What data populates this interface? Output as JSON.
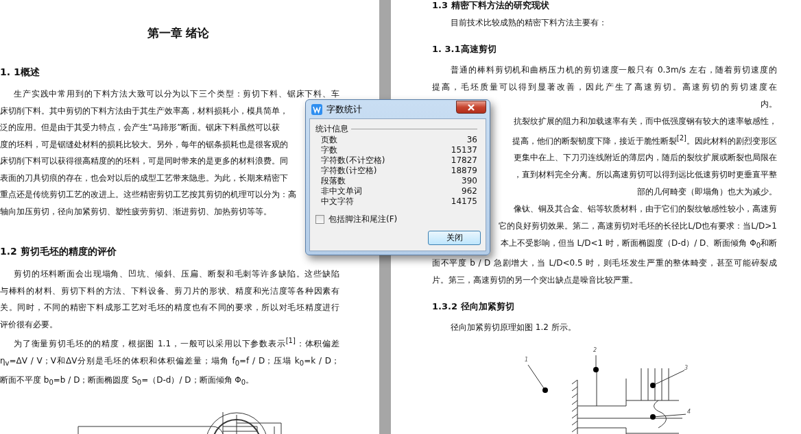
{
  "left_page": {
    "chapter_title": "第一章  绪论",
    "sections": [
      {
        "heading": "1. 1概述",
        "paragraphs": [
          [
            {
              "text": "生产实践中常用到的下料方法大致可以分为以下三个类型：剪切下料、锯床下料、车",
              "kind": "full"
            },
            {
              "text": "床切削下料。其中剪切的下料方法由于其生产效率高，材料损耗小，模具简单，",
              "kind": "covered"
            },
            {
              "text": "泛的应用。但是由于其受力特点，会产生“马蹄形”断面。锯床下料虽然可以获",
              "kind": "covered"
            },
            {
              "text": "度的坯料，可是锯缝处材料的损耗比较大。另外，每年的锯条损耗也是很客观的",
              "kind": "covered"
            },
            {
              "text": "床切削下料可以获得很高精度的的坯料，可是同时带来的是更多的材料浪费。同",
              "kind": "covered"
            },
            {
              "text": "表面的刀具切痕的存在，也会对以后的成型工艺带来隐患。为此，长期来精密下",
              "kind": "covered"
            },
            {
              "text": "重点还是传统剪切工艺的改进上。这些精密剪切工艺按其剪切的机理可以分为：高",
              "kind": "covered"
            },
            {
              "text": "轴向加压剪切，径向加紧剪切、塑性疲劳剪切、渐进剪切、加热剪切等等。",
              "kind": "last"
            }
          ]
        ]
      },
      {
        "heading": "1.2 剪切毛坯的精度的评价",
        "paragraphs": [
          [
            {
              "text": "剪切的坯料断面会出现塌角、凹坑、倾斜、压扁、断裂和毛刺等许多缺陷。这些缺陷",
              "kind": "full"
            },
            {
              "text": "与棒料的材料、剪切下料的方法、下料设备、剪刀片的形状、精度和光洁度等各种因素有",
              "kind": "full"
            },
            {
              "text": "关。同时，不同的精密下料成形工艺对毛坯的精度也有不同的要求，所以对毛坯精度进行",
              "kind": "full"
            },
            {
              "text": "评价很有必要。",
              "kind": "last"
            }
          ],
          [
            {
              "text": "为了衡量剪切毛坯的的精度，根据图 1.1，一般可以采用以下参数表示$^{[1]}$：体积偏差",
              "kind": "full"
            },
            {
              "text": "η$_{v}$=ΔV / V；V和ΔV分别是毛坯的体积和体积偏差量；塌角 f$_{0}$=f / D；压塌 k$_{0}$=k / D；",
              "kind": "full"
            },
            {
              "text": "断面不平度 b$_{0}$=b / D；断面椭圆度 S$_{0}$=（D-d）/ D；断面倾角 Φ$_{0}$。",
              "kind": "last"
            }
          ]
        ]
      }
    ]
  },
  "right_page": {
    "blocks": [
      {
        "kind": "heading",
        "text": "1.3 精密下料方法的研究现状"
      },
      {
        "kind": "paragraph",
        "lines": [
          {
            "text": "目前技术比较成熟的精密下料方法主要有：",
            "kind": "last"
          }
        ]
      },
      {
        "kind": "heading",
        "text": "1. 3.1高速剪切"
      },
      {
        "kind": "paragraph",
        "lines": [
          {
            "text": "普通的棒料剪切机和曲柄压力机的剪切速度一般只有 0.3m/s 左右，随着剪切速度的",
            "kind": "full"
          },
          {
            "text": "提高，毛坯质量可以得到显著改善，因此产生了高速剪切。高速剪切的剪切速度在",
            "kind": "full"
          },
          {
            "text": "内。",
            "kind": "covered"
          },
          {
            "text": "抗裂纹扩展的阻力和加载速率有关，而中低强度钢有较大的速率敏感性，",
            "kind": "covered"
          },
          {
            "text": "提高，他们的断裂韧度下降，接近于脆性断裂$^{[2]}$。因此材料的剧烈变形区",
            "kind": "covered"
          },
          {
            "text": "更集中在上、下刀刃连线附近的薄层内，随后的裂纹扩展或断裂也局限在",
            "kind": "covered"
          },
          {
            "text": "，直到材料完全分离。所以高速剪切可以得到远比低速剪切时更垂直平整",
            "kind": "covered"
          },
          {
            "text": "部的几何畸变（即塌角）也大为减少。",
            "kind": "covered"
          },
          {
            "text": "像钛、铜及其合金、铝等软质材料，由于它们的裂纹敏感性较小，高速剪",
            "kind": "covered"
          },
          {
            "text": "它的良好剪切效果。第二，高速剪切对毛坯的长径比L/D也有要求：当L/D>1",
            "kind": "covered"
          },
          {
            "text": "本上不受影响，但当 L/D<1 时，断面椭圆度（D-d）/ D、断面倾角 Φ$_{0}$和断",
            "kind": "covered"
          },
          {
            "text": "面不平度 b / D 急剧增大，当 L/D<0.5 时，则毛坯发生严重的整体畸变，甚至可能碎裂成",
            "kind": "full"
          },
          {
            "text": "片。第三，高速剪切的另一个突出缺点是噪音比较严重。",
            "kind": "last"
          }
        ]
      },
      {
        "kind": "heading",
        "text": "1.3.2 径向加紧剪切"
      },
      {
        "kind": "paragraph",
        "lines": [
          {
            "text": "径向加紧剪切原理如图 1.2 所示。",
            "kind": "last"
          }
        ]
      },
      {
        "kind": "figure",
        "labels": [
          "1",
          "2",
          "3",
          "4"
        ]
      }
    ]
  },
  "dialog": {
    "title": "字数统计",
    "group_label": "统计信息",
    "stats": [
      {
        "label": "页数",
        "value": "36"
      },
      {
        "label": "字数",
        "value": "15137"
      },
      {
        "label": "字符数(不计空格)",
        "value": "17827"
      },
      {
        "label": "字符数(计空格)",
        "value": "18879"
      },
      {
        "label": "段落数",
        "value": "390"
      },
      {
        "label": "非中文单词",
        "value": "962"
      },
      {
        "label": "中文字符",
        "value": "14175"
      }
    ],
    "checkbox": {
      "label": "包括脚注和尾注(F)",
      "checked": false
    },
    "button": "关闭"
  }
}
